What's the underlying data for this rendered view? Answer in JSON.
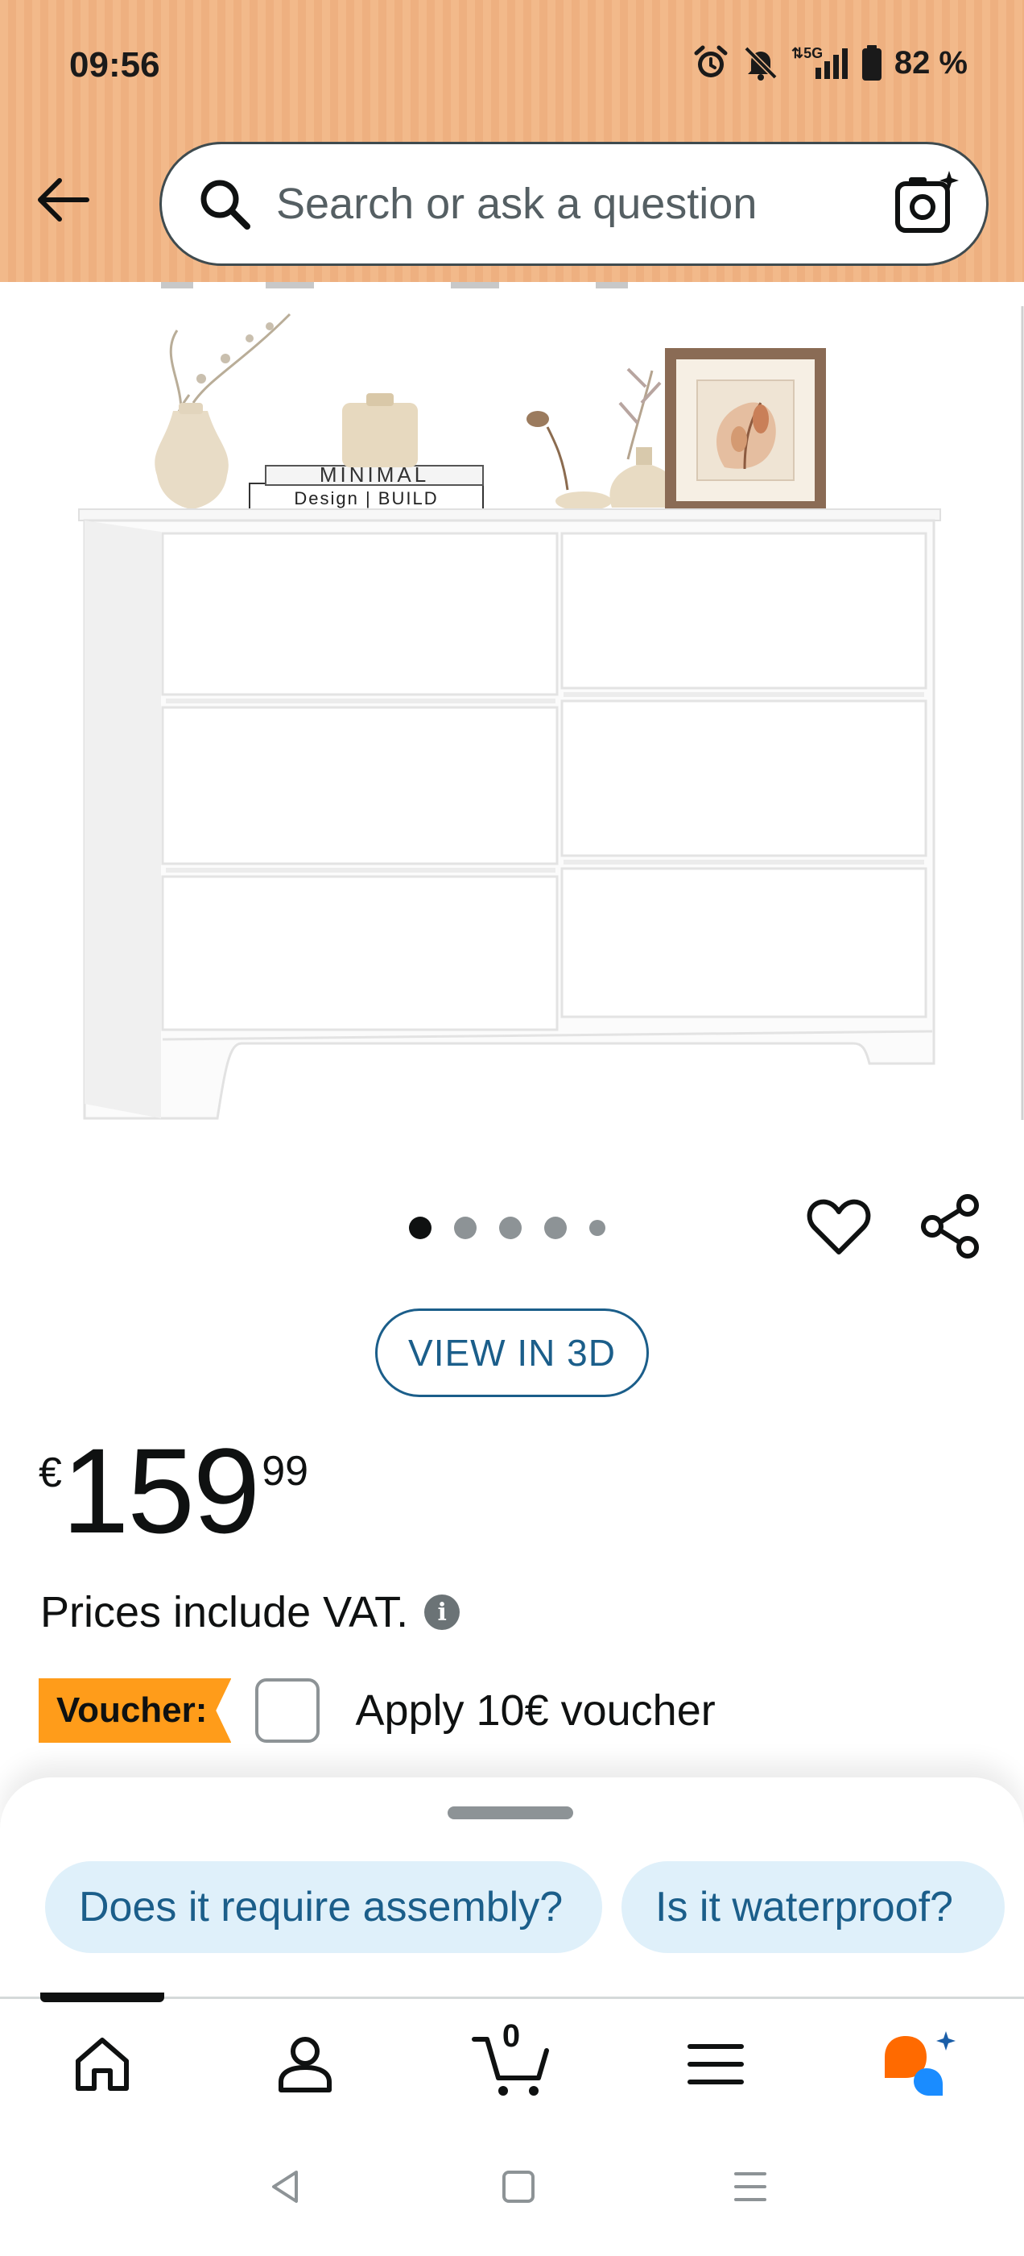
{
  "status_bar": {
    "time": "09:56",
    "network": "5G",
    "battery": "82 %"
  },
  "search": {
    "placeholder": "Search or ask a question"
  },
  "product_image": {
    "book_top_text": "MINIMAL",
    "book_bottom_text": "Design | BUILD"
  },
  "carousel": {
    "image_count": 5,
    "active_index": 0
  },
  "view_3d_label": "VIEW IN 3D",
  "price": {
    "currency": "€",
    "whole": "159",
    "fraction": "99"
  },
  "vat_text": "Prices include VAT.",
  "voucher": {
    "badge": "Voucher:",
    "label": "Apply 10€ voucher"
  },
  "suggestions": [
    {
      "label": "Does it require assembly?"
    },
    {
      "label": "Is it waterproof?"
    }
  ],
  "nav": {
    "cart_count": "0",
    "items": [
      "home-icon",
      "account-icon",
      "cart-icon",
      "menu-icon",
      "rufus-icon"
    ]
  },
  "colors": {
    "header_bg": "#f2b98a",
    "link_blue": "#1b5e8a",
    "voucher_orange": "#ff9c1a",
    "chip_bg": "#dff0fa",
    "assistant_orange": "#ff6a00",
    "assistant_blue": "#1a8cff"
  }
}
